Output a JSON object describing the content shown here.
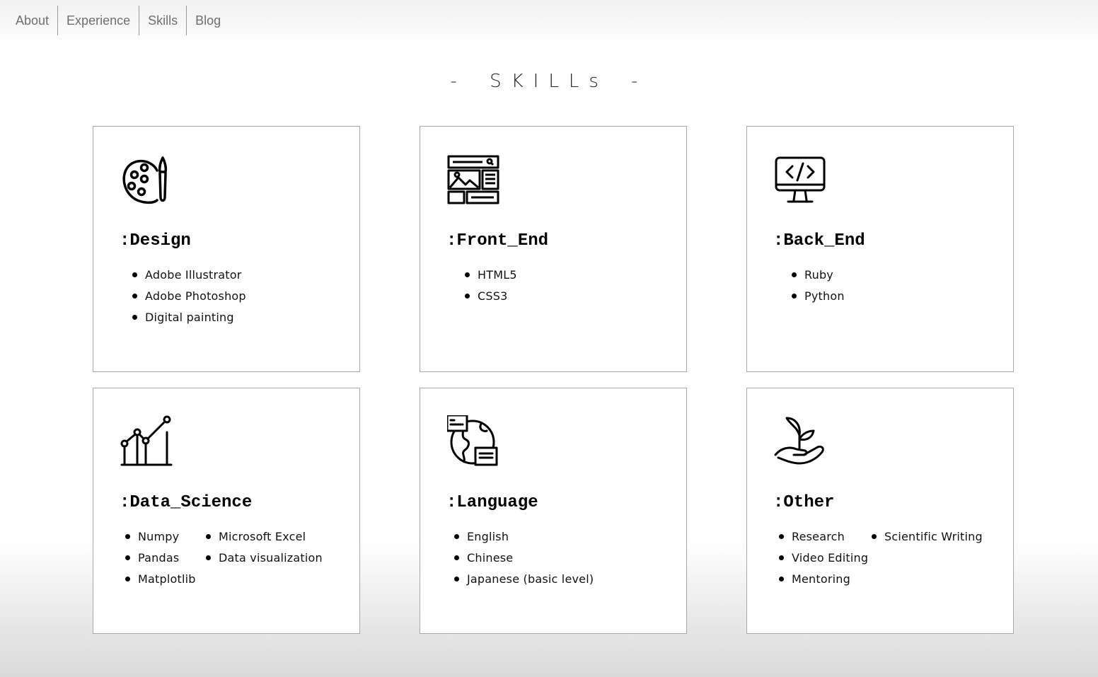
{
  "nav": {
    "items": [
      "About",
      "Experience",
      "Skills",
      "Blog"
    ]
  },
  "section_title": "- SKILLs -",
  "cards": [
    {
      "icon": "palette-icon",
      "title": ":Design",
      "columns": [
        [
          "Adobe Illustrator",
          "Adobe Photoshop",
          "Digital painting"
        ]
      ]
    },
    {
      "icon": "web-layout-icon",
      "title": ":Front_End",
      "columns": [
        [
          "HTML5",
          "CSS3"
        ]
      ]
    },
    {
      "icon": "code-monitor-icon",
      "title": ":Back_End",
      "columns": [
        [
          "Ruby",
          "Python"
        ]
      ]
    },
    {
      "icon": "line-chart-icon",
      "title": ":Data_Science",
      "columns": [
        [
          "Numpy",
          "Pandas",
          "Matplotlib"
        ],
        [
          "Microsoft Excel",
          "Data visualization"
        ]
      ]
    },
    {
      "icon": "globe-chat-icon",
      "title": ":Language",
      "columns": [
        [
          "English",
          "Chinese",
          "Japanese (basic level)"
        ]
      ]
    },
    {
      "icon": "hand-plant-icon",
      "title": ":Other",
      "columns": [
        [
          "Research",
          "Video Editing",
          "Mentoring"
        ],
        [
          "Scientific Writing"
        ]
      ]
    }
  ]
}
